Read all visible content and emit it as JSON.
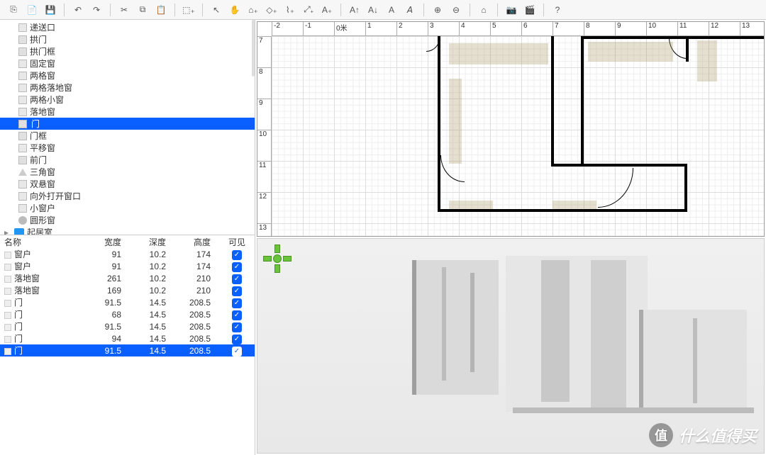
{
  "toolbar_icons": [
    {
      "name": "new-file-icon",
      "g": "⎘"
    },
    {
      "name": "open-file-icon",
      "g": "📄"
    },
    {
      "name": "save-file-icon",
      "g": "💾"
    },
    {
      "name": "sep"
    },
    {
      "name": "undo-icon",
      "g": "↶"
    },
    {
      "name": "redo-icon",
      "g": "↷"
    },
    {
      "name": "sep"
    },
    {
      "name": "cut-icon",
      "g": "✂"
    },
    {
      "name": "copy-icon",
      "g": "⧉"
    },
    {
      "name": "paste-icon",
      "g": "📋"
    },
    {
      "name": "sep"
    },
    {
      "name": "add-furniture-icon",
      "g": "⬚₊"
    },
    {
      "name": "sep"
    },
    {
      "name": "select-icon",
      "g": "↖"
    },
    {
      "name": "pan-icon",
      "g": "✋"
    },
    {
      "name": "create-wall-icon",
      "g": "⌂₊"
    },
    {
      "name": "create-room-icon",
      "g": "◇₊"
    },
    {
      "name": "create-polyline-icon",
      "g": "⌇₊"
    },
    {
      "name": "create-dimension-icon",
      "g": "⤢₊"
    },
    {
      "name": "create-text-icon",
      "g": "A₊"
    },
    {
      "name": "sep"
    },
    {
      "name": "increase-text-icon",
      "g": "A↑"
    },
    {
      "name": "decrease-text-icon",
      "g": "A↓"
    },
    {
      "name": "bold-icon",
      "g": "A"
    },
    {
      "name": "italic-icon",
      "g": "𝘈"
    },
    {
      "name": "sep"
    },
    {
      "name": "zoom-in-icon",
      "g": "⊕"
    },
    {
      "name": "zoom-out-icon",
      "g": "⊖"
    },
    {
      "name": "sep"
    },
    {
      "name": "store-viewpoint-icon",
      "g": "⌂"
    },
    {
      "name": "sep"
    },
    {
      "name": "photo-icon",
      "g": "📷"
    },
    {
      "name": "video-icon",
      "g": "🎬"
    },
    {
      "name": "sep"
    },
    {
      "name": "help-icon",
      "g": "?"
    }
  ],
  "library": {
    "items": [
      {
        "label": "递送口",
        "icon": "win"
      },
      {
        "label": "拱门",
        "icon": "door"
      },
      {
        "label": "拱门框",
        "icon": "door"
      },
      {
        "label": "固定窗",
        "icon": "win"
      },
      {
        "label": "两格窗",
        "icon": "win"
      },
      {
        "label": "两格落地窗",
        "icon": "win"
      },
      {
        "label": "两格小窗",
        "icon": "win"
      },
      {
        "label": "落地窗",
        "icon": "win"
      },
      {
        "label": "门",
        "icon": "door",
        "selected": true
      },
      {
        "label": "门框",
        "icon": "door"
      },
      {
        "label": "平移窗",
        "icon": "win"
      },
      {
        "label": "前门",
        "icon": "door"
      },
      {
        "label": "三角窗",
        "icon": "tri"
      },
      {
        "label": "双悬窗",
        "icon": "win"
      },
      {
        "label": "向外打开窗口",
        "icon": "win"
      },
      {
        "label": "小窗户",
        "icon": "win"
      },
      {
        "label": "圆形窗",
        "icon": "circle"
      }
    ],
    "folder": {
      "label": "起居室"
    }
  },
  "furniture_table": {
    "headers": {
      "name": "名称",
      "width": "宽度",
      "depth": "深度",
      "height": "高度",
      "visible": "可见"
    },
    "rows": [
      {
        "name": "窗户",
        "width": "91",
        "depth": "10.2",
        "height": "174",
        "v": true
      },
      {
        "name": "窗户",
        "width": "91",
        "depth": "10.2",
        "height": "174",
        "v": true
      },
      {
        "name": "落地窗",
        "width": "261",
        "depth": "10.2",
        "height": "210",
        "v": true
      },
      {
        "name": "落地窗",
        "width": "169",
        "depth": "10.2",
        "height": "210",
        "v": true
      },
      {
        "name": "门",
        "width": "91.5",
        "depth": "14.5",
        "height": "208.5",
        "v": true
      },
      {
        "name": "门",
        "width": "68",
        "depth": "14.5",
        "height": "208.5",
        "v": true
      },
      {
        "name": "门",
        "width": "91.5",
        "depth": "14.5",
        "height": "208.5",
        "v": true
      },
      {
        "name": "门",
        "width": "94",
        "depth": "14.5",
        "height": "208.5",
        "v": true
      },
      {
        "name": "门",
        "width": "91.5",
        "depth": "14.5",
        "height": "208.5",
        "v": true,
        "sel": true
      }
    ]
  },
  "plan": {
    "ruler_h": [
      "-2",
      "-1",
      "0米",
      "1",
      "2",
      "3",
      "4",
      "5",
      "6",
      "7",
      "8",
      "9",
      "10",
      "11",
      "12",
      "13"
    ],
    "ruler_v": [
      "7",
      "8",
      "9",
      "10",
      "11",
      "12",
      "13"
    ]
  },
  "watermark": {
    "badge": "值",
    "text": "什么值得买"
  }
}
